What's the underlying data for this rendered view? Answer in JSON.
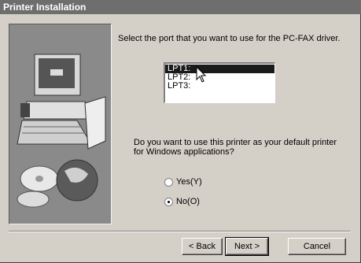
{
  "window": {
    "title": "Printer Installation"
  },
  "instruction": "Select the port that you want to use for the PC-FAX driver.",
  "ports": [
    {
      "label": "LPT1:",
      "selected": true
    },
    {
      "label": "LPT2:",
      "selected": false
    },
    {
      "label": "LPT3:",
      "selected": false
    }
  ],
  "question": "Do you want to use this printer as your default printer for Windows applications?",
  "options": {
    "yes": {
      "label": "Yes(Y)",
      "checked": false
    },
    "no": {
      "label": "No(O)",
      "checked": true
    }
  },
  "buttons": {
    "back": "< Back",
    "next": "Next >",
    "cancel": "Cancel"
  }
}
